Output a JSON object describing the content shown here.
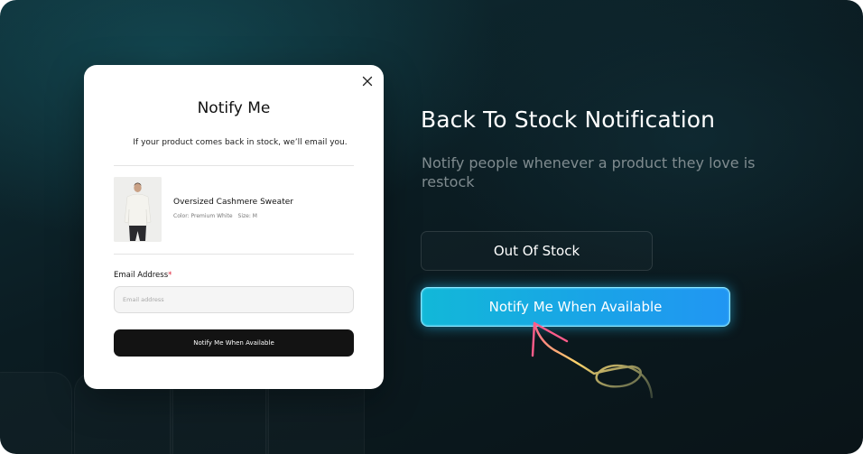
{
  "modal": {
    "title": "Notify Me",
    "subtitle": "If your product comes back in stock, we’ll email you.",
    "product": {
      "name": "Oversized Cashmere Sweater",
      "color_label": "Color: Premium White",
      "size_label": "Size: M"
    },
    "email_label": "Email Address",
    "required_mark": "*",
    "email_placeholder": "Email address",
    "email_value": "",
    "submit_label": "Notify Me When Available",
    "close_icon": "close-icon"
  },
  "hero": {
    "title": "Back To Stock Notification",
    "subtitle": "Notify people whenever a product they love is restock"
  },
  "buttons": {
    "out_of_stock_label": "Out Of Stock",
    "notify_label": "Notify Me When Available"
  },
  "colors": {
    "background": "#0b1c22",
    "accent": "#1aa2e8",
    "modal_button": "#131313",
    "required": "#e0243a"
  }
}
